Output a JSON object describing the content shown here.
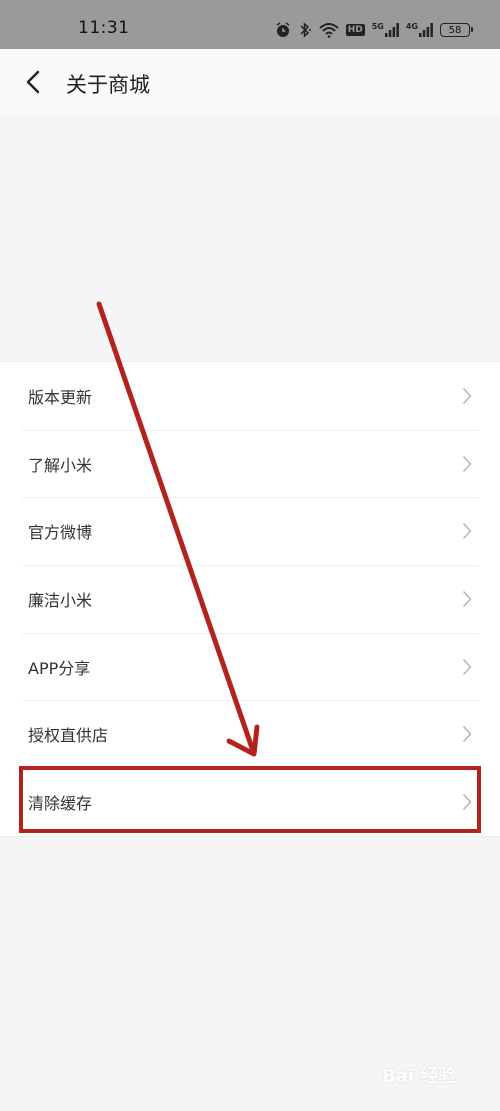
{
  "status_bar": {
    "time": "11:31",
    "battery_level": "58",
    "hd_label": "HD",
    "net_5g": "5G",
    "net_4g": "4G",
    "icons": [
      "alarm-icon",
      "bluetooth-icon",
      "wifi-icon",
      "hd-icon",
      "signal-5g-icon",
      "signal-4g-icon",
      "battery-icon"
    ]
  },
  "header": {
    "title": "关于商城",
    "back_icon": "chevron-left-icon"
  },
  "menu": {
    "items": [
      {
        "label": "版本更新"
      },
      {
        "label": "了解小米"
      },
      {
        "label": "官方微博"
      },
      {
        "label": "廉洁小米"
      },
      {
        "label": "APP分享"
      },
      {
        "label": "授权直供店"
      },
      {
        "label": "清除缓存"
      }
    ]
  },
  "annotation": {
    "color": "#b3231e",
    "highlighted_item": "清除缓存"
  },
  "watermark": {
    "text": "Bai 经验"
  },
  "colors": {
    "status_bar_bg": "#9a9a9a",
    "page_bg": "#f5f5f5",
    "list_bg": "#ffffff",
    "text": "#333333",
    "chevron": "#b5b5b5"
  }
}
